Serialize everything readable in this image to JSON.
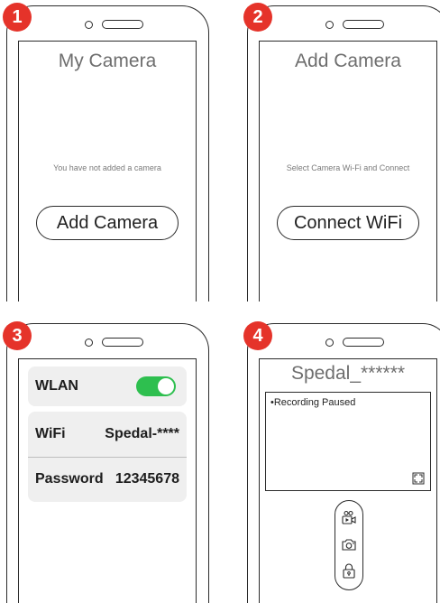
{
  "steps": [
    {
      "number": "1",
      "screen_title": "My Camera",
      "hint": "You have not added a camera",
      "button_label": "Add Camera"
    },
    {
      "number": "2",
      "screen_title": "Add Camera",
      "hint": "Select Camera Wi-Fi and Connect",
      "button_label": "Connect WiFi"
    },
    {
      "number": "3",
      "wlan_label": "WLAN",
      "wlan_enabled": true,
      "wifi_label": "WiFi",
      "wifi_value": "Spedal-****",
      "password_label": "Password",
      "password_value": "12345678"
    },
    {
      "number": "4",
      "screen_title": "Spedal_******",
      "status": "•Recording Paused",
      "control_icons": [
        "video-record-icon",
        "camera-icon",
        "lock-icon"
      ]
    }
  ],
  "colors": {
    "badge": "#e5332a",
    "toggle_on": "#2ebf4f",
    "card_bg": "#efefef",
    "outline": "#2b2b2b"
  }
}
